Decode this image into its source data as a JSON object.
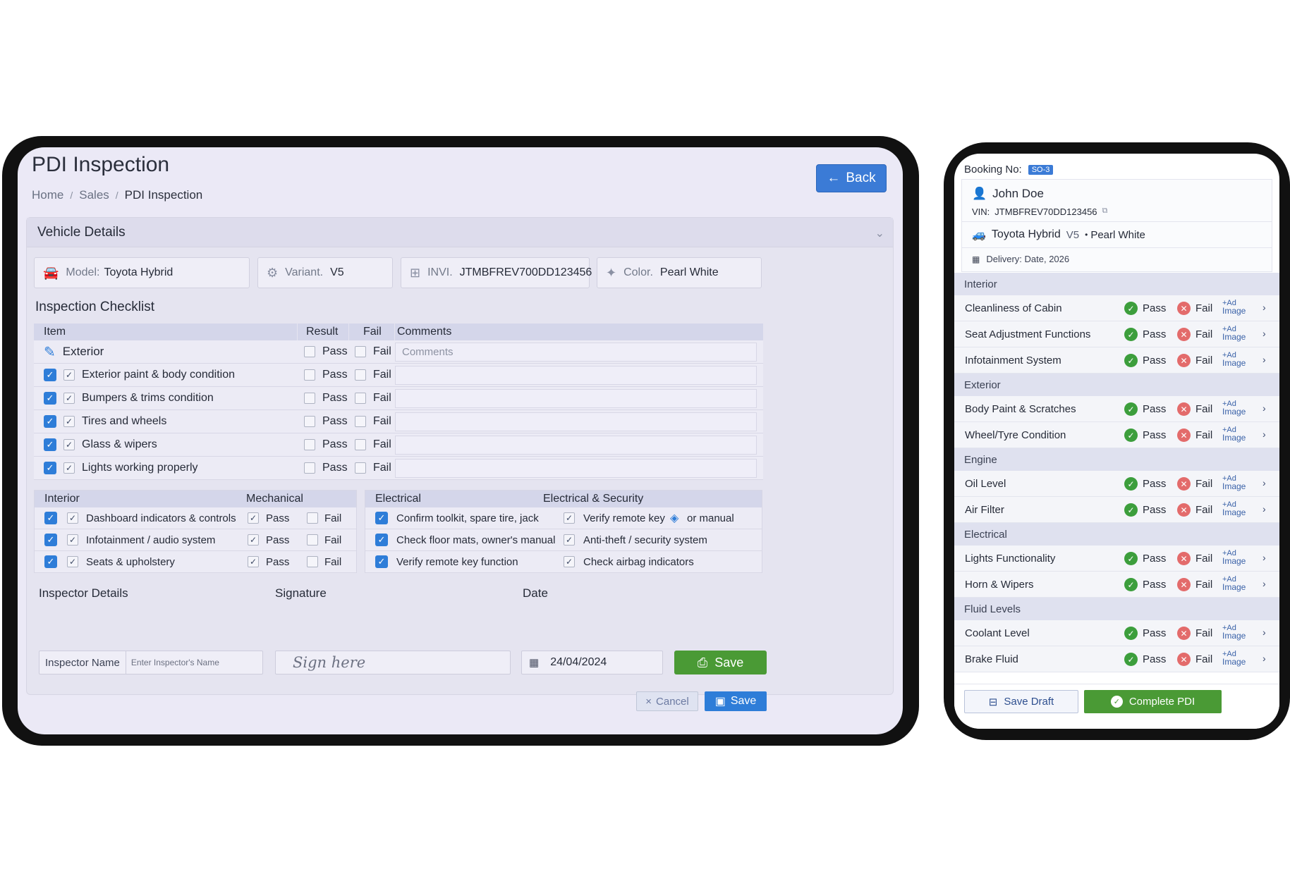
{
  "tablet": {
    "title": "PDI Inspection",
    "breadcrumb": [
      "Home",
      "Sales",
      "PDI Inspection"
    ],
    "breadcrumb_sep": "/",
    "back_label": "Back",
    "vehicle_section": "Vehicle Details",
    "vehicle": {
      "model_key": "Model:",
      "model_val": "Toyota Hybrid",
      "variant_key": "Variant.",
      "variant_val": "V5",
      "vin_key": "INVI.",
      "vin_val": "JTMBFREV700DD123456",
      "color_key": "Color.",
      "color_val": "Pearl White"
    },
    "checklist_title": "Inspection Checklist",
    "columns": {
      "item": "Item",
      "result": "Result",
      "fail": "Fail",
      "comments": "Comments"
    },
    "exterior_group": "Exterior",
    "comments_placeholder": "Comments",
    "pass_label": "Pass",
    "fail_label": "Fail",
    "exterior_items": [
      "Exterior paint & body condition",
      "Bumpers & trims condition",
      "Tires and wheels",
      "Glass & wipers",
      "Lights working properly"
    ],
    "interior_head": "Interior",
    "mechanical_head": "Mechanical",
    "interior_items": [
      "Dashboard indicators & controls",
      "Infotainment / audio system",
      "Seats & upholstery"
    ],
    "electrical_head": "Electrical",
    "electrical_security_head": "Electrical & Security",
    "electrical_items": [
      "Confirm toolkit, spare tire, jack",
      "Check floor mats, owner's manual",
      "Verify remote key function"
    ],
    "security_items": [
      "Verify remote key",
      "Anti-theft / security system",
      "Check airbag indicators"
    ],
    "security_item0_suffix": "or manual",
    "inspector_details": "Inspector Details",
    "inspector_name_label": "Inspector Name",
    "inspector_name_placeholder": "Enter Inspector's Name",
    "signature_label": "Signature",
    "signature_placeholder": "Sign here",
    "date_label": "Date",
    "date_value": "24/04/2024",
    "save_big": "Save",
    "cancel": "Cancel",
    "save": "Save"
  },
  "phone": {
    "booking_label": "Booking No:",
    "booking_no": "SO-3",
    "customer": "John Doe",
    "vin_label": "VIN:",
    "vin": "JTMBFREV70DD123456",
    "vehicle": "Toyota Hybrid",
    "variant": "V5",
    "color": "Pearl White",
    "delivery": "Delivery: Date, 2026",
    "pass": "Pass",
    "fail": "Fail",
    "add_image_top": "+Ad",
    "add_image_bottom": "Image",
    "groups": [
      {
        "name": "Interior",
        "items": [
          "Cleanliness of Cabin",
          "Seat Adjustment Functions",
          "Infotainment System"
        ]
      },
      {
        "name": "Exterior",
        "items": [
          "Body Paint & Scratches",
          "Wheel/Tyre Condition"
        ]
      },
      {
        "name": "Engine",
        "items": [
          "Oil Level",
          "Air Filter"
        ]
      },
      {
        "name": "Electrical",
        "items": [
          "Lights Functionality",
          "Horn & Wipers"
        ]
      },
      {
        "name": "Fluid Levels",
        "items": [
          "Coolant Level",
          "Brake Fluid"
        ]
      }
    ],
    "save_draft": "Save Draft",
    "complete": "Complete PDI"
  }
}
